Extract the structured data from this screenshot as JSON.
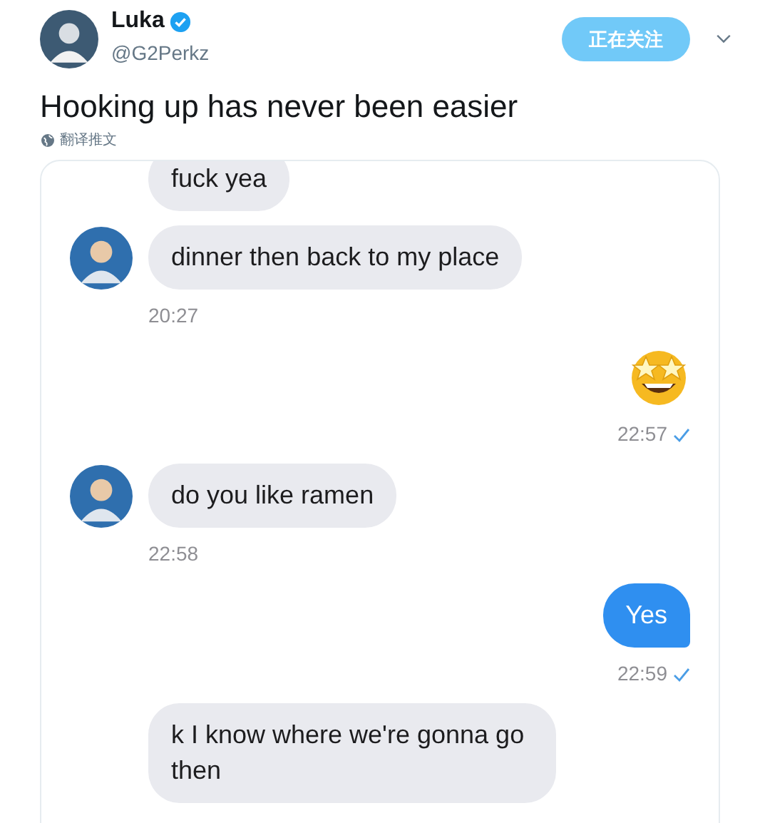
{
  "author": {
    "name": "Luka",
    "verified": true,
    "handle": "@G2Perkz"
  },
  "follow_button": {
    "label": "正在关注"
  },
  "tweet_text": "Hooking up has never been easier",
  "translate_link": "翻译推文",
  "messages": [
    {
      "kind": "in",
      "text": "fuck yea",
      "avatar": false
    },
    {
      "kind": "in",
      "text": "dinner then back to my place",
      "avatar": true,
      "time": "20:27"
    },
    {
      "kind": "emoji",
      "time": "22:57",
      "read": true
    },
    {
      "kind": "in",
      "text": "do you like ramen",
      "avatar": true,
      "time": "22:58"
    },
    {
      "kind": "out",
      "text": "Yes",
      "time": "22:59",
      "read": true
    },
    {
      "kind": "in",
      "text": "k I know where we're gonna go then",
      "avatar": false
    }
  ]
}
